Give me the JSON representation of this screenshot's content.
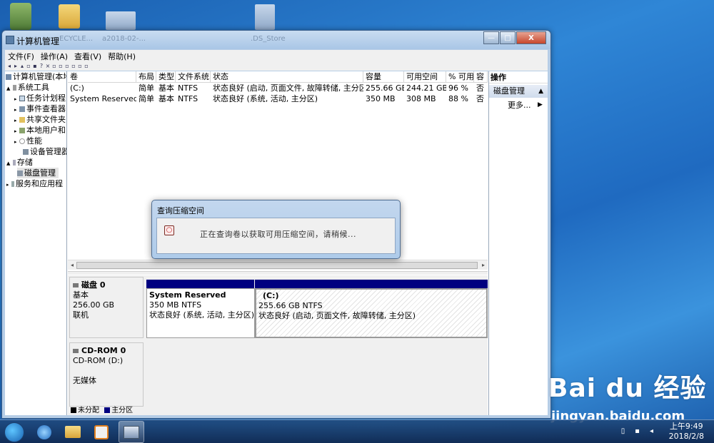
{
  "desktop": {
    "ghost_labels": [
      "ECYCLE...",
      "a2018-02-...",
      ".DS_Store"
    ]
  },
  "window": {
    "title": "计算机管理",
    "controls": {
      "minimize": "—",
      "maximize": "□",
      "close": "X"
    }
  },
  "menu": [
    "文件(F)",
    "操作(A)",
    "查看(V)",
    "帮助(H)"
  ],
  "toolbar_icons": [
    "back-icon",
    "forward-icon",
    "up-icon",
    "folder-icon",
    "properties-icon",
    "help-icon",
    "delete-icon",
    "settings-icon",
    "new-icon",
    "open-icon",
    "search-icon",
    "magnify-icon",
    "refresh-icon"
  ],
  "tree": {
    "items": [
      {
        "label": "计算机管理(本地",
        "level": 0,
        "expander": ""
      },
      {
        "label": "系统工具",
        "level": 1,
        "expander": "▲"
      },
      {
        "label": "任务计划程",
        "level": 2,
        "expander": "▸"
      },
      {
        "label": "事件查看器",
        "level": 2,
        "expander": "▸"
      },
      {
        "label": "共享文件夹",
        "level": 2,
        "expander": "▸"
      },
      {
        "label": "本地用户和",
        "level": 2,
        "expander": "▸"
      },
      {
        "label": "性能",
        "level": 2,
        "expander": "▸"
      },
      {
        "label": "设备管理器",
        "level": 2,
        "expander": ""
      },
      {
        "label": "存储",
        "level": 1,
        "expander": "▲"
      },
      {
        "label": "磁盘管理",
        "level": 2,
        "expander": ""
      },
      {
        "label": "服务和应用程",
        "level": 1,
        "expander": "▸"
      }
    ]
  },
  "volume_table": {
    "columns": [
      "卷",
      "布局",
      "类型",
      "文件系统",
      "状态",
      "容量",
      "可用空间",
      "% 可用",
      "容"
    ],
    "rows": [
      [
        "(C:)",
        "简单",
        "基本",
        "NTFS",
        "状态良好 (启动, 页面文件, 故障转储, 主分区)",
        "255.66 GB",
        "244.21 GB",
        "96 %",
        "否"
      ],
      [
        "System Reserved",
        "简单",
        "基本",
        "NTFS",
        "状态良好 (系统, 活动, 主分区)",
        "350 MB",
        "308 MB",
        "88 %",
        "否"
      ]
    ]
  },
  "disks": {
    "disk0": {
      "name": "磁盘 0",
      "type": "基本",
      "size": "256.00 GB",
      "status": "联机",
      "partitions": [
        {
          "name": "System Reserved",
          "size": "350 MB NTFS",
          "status": "状态良好 (系统, 活动, 主分区)"
        },
        {
          "name": "(C:)",
          "size": "255.66 GB NTFS",
          "status": "状态良好 (启动, 页面文件, 故障转储, 主分区)"
        }
      ]
    },
    "cdrom0": {
      "name": "CD-ROM 0",
      "drive": "CD-ROM (D:)",
      "media": "无媒体"
    },
    "legend": [
      "未分配",
      "主分区"
    ]
  },
  "actions": {
    "header": "操作",
    "section": "磁盘管理",
    "more": "更多..."
  },
  "dialog": {
    "title": "查询压缩空间",
    "message": "正在查询卷以获取可用压缩空间，请稍候..."
  },
  "taskbar": {
    "time": "上午9:49",
    "date": "2018/2/8"
  },
  "watermark": {
    "main": "Bai du 经验",
    "sub": "jingyan.baidu.com"
  },
  "colors": {
    "partition_bar": "#000080",
    "desktop": "#2f86d6"
  }
}
